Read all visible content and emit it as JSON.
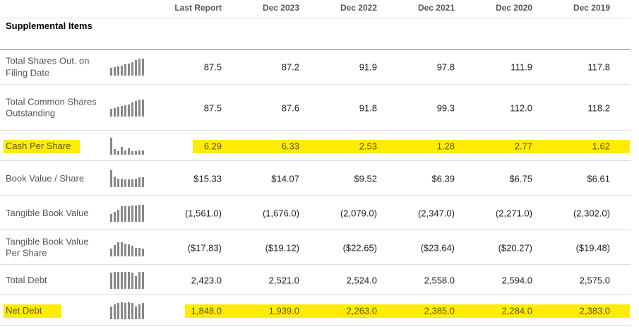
{
  "columns": [
    "Last Report",
    "Dec 2023",
    "Dec 2022",
    "Dec 2021",
    "Dec 2020",
    "Dec 2019"
  ],
  "section_title": "Supplemental Items",
  "highlight_color": "#ffec00",
  "rows": [
    {
      "label": "Total Shares Out. on Filing Date",
      "values": [
        "87.5",
        "87.2",
        "91.9",
        "97.8",
        "111.9",
        "117.8"
      ],
      "spark": [
        0.45,
        0.5,
        0.55,
        0.6,
        0.65,
        0.7,
        0.8,
        0.9,
        1,
        1
      ],
      "highlighted": false
    },
    {
      "label": "Total Common Shares Outstanding",
      "values": [
        "87.5",
        "87.6",
        "91.8",
        "99.3",
        "112.0",
        "118.2"
      ],
      "spark": [
        0.45,
        0.5,
        0.55,
        0.6,
        0.65,
        0.7,
        0.8,
        0.9,
        1,
        1
      ],
      "highlighted": false
    },
    {
      "label": "Cash Per Share",
      "values": [
        "6.29",
        "6.33",
        "2.53",
        "1.28",
        "2.77",
        "1.62"
      ],
      "spark": [
        1,
        0.3,
        0.2,
        0.45,
        0.25,
        0.35,
        0.2,
        0.2,
        0.25,
        0.25
      ],
      "highlighted": true
    },
    {
      "label": "Book Value / Share",
      "values": [
        "$15.33",
        "$14.07",
        "$9.52",
        "$6.39",
        "$6.75",
        "$6.61"
      ],
      "spark": [
        1,
        0.6,
        0.5,
        0.5,
        0.45,
        0.45,
        0.45,
        0.5,
        0.55,
        0.55
      ],
      "highlighted": false
    },
    {
      "label": "Tangible Book Value",
      "values": [
        "(1,561.0)",
        "(1,676.0)",
        "(2,079.0)",
        "(2,347.0)",
        "(2,271.0)",
        "(2,302.0)"
      ],
      "spark": [
        0.45,
        0.55,
        0.7,
        0.9,
        0.9,
        0.9,
        0.95,
        0.95,
        1,
        1
      ],
      "highlighted": false
    },
    {
      "label": "Tangible Book Value Per Share",
      "values": [
        "($17.83)",
        "($19.12)",
        "($22.65)",
        "($23.64)",
        "($20.27)",
        "($19.48)"
      ],
      "spark": [
        0.45,
        0.65,
        0.8,
        0.8,
        0.75,
        0.7,
        0.6,
        0.5,
        0.5,
        0.45
      ],
      "highlighted": false
    },
    {
      "label": "Total Debt",
      "values": [
        "2,423.0",
        "2,521.0",
        "2,524.0",
        "2,558.0",
        "2,594.0",
        "2,575.0"
      ],
      "spark": [
        0.95,
        1,
        1,
        1,
        1,
        1,
        0.95,
        0.75,
        1,
        1
      ],
      "highlighted": false
    },
    {
      "label": "Net Debt",
      "values": [
        "1,848.0",
        "1,939.0",
        "2,263.0",
        "2,385.0",
        "2,284.0",
        "2,383.0"
      ],
      "spark": [
        0.75,
        0.85,
        0.95,
        1,
        0.95,
        1,
        0.95,
        0.75,
        0.85,
        0.95
      ],
      "highlighted": true
    }
  ]
}
